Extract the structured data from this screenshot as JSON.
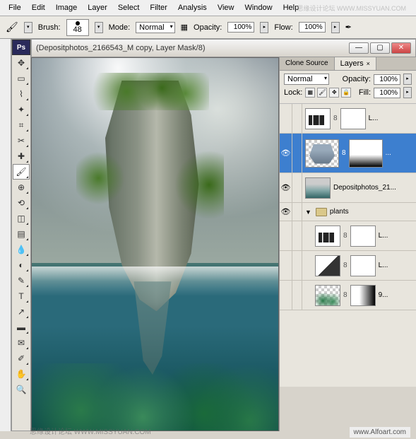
{
  "menu": [
    "File",
    "Edit",
    "Image",
    "Layer",
    "Select",
    "Filter",
    "Analysis",
    "View",
    "Window",
    "Help"
  ],
  "options": {
    "brush_label": "Brush:",
    "brush_size": "48",
    "mode_label": "Mode:",
    "mode_value": "Normal",
    "opacity_label": "Opacity:",
    "opacity_value": "100%",
    "flow_label": "Flow:",
    "flow_value": "100%"
  },
  "document": {
    "title": "(Depositphotos_2166543_M copy, Layer Mask/8)"
  },
  "panels": {
    "tabs": [
      "Clone Source",
      "Layers"
    ],
    "active_tab": 1,
    "blend_mode": "Normal",
    "opacity_label": "Opacity:",
    "opacity_value": "100%",
    "lock_label": "Lock:",
    "fill_label": "Fill:",
    "fill_value": "100%"
  },
  "layers": [
    {
      "visible": false,
      "type": "adjustment",
      "label": "L..."
    },
    {
      "visible": true,
      "type": "smart",
      "label": "...",
      "selected": true
    },
    {
      "visible": true,
      "type": "image",
      "label": "Depositphotos_21..."
    },
    {
      "visible": true,
      "type": "group",
      "label": "plants"
    },
    {
      "visible": false,
      "type": "adjustment",
      "label": "L..."
    },
    {
      "visible": false,
      "type": "adjustment2",
      "label": "L..."
    },
    {
      "visible": false,
      "type": "coral",
      "label": "9..."
    }
  ],
  "watermarks": {
    "top_right": "思缘设计论坛 WWW.MISSYUAN.COM",
    "bottom_left": "思缘设计论坛 WWW.MISSYUAN.COM",
    "bottom_right": "www.Alfoart.com"
  },
  "ps_label": "Ps"
}
